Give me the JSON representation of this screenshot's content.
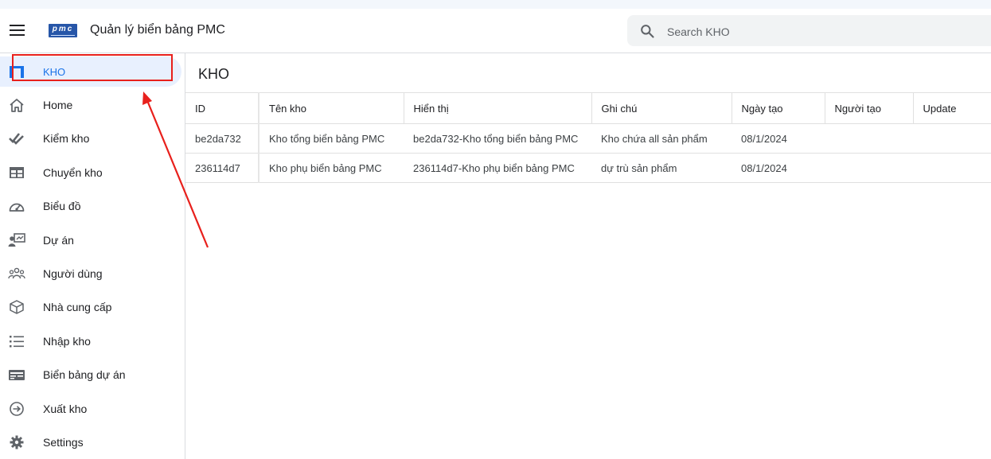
{
  "app": {
    "title": "Quản lý biển bảng PMC",
    "logo_text": "pmc"
  },
  "search": {
    "placeholder": "Search KHO"
  },
  "sidebar": {
    "items": [
      {
        "label": "KHO",
        "icon": "warehouse-icon",
        "active": true
      },
      {
        "label": "Home",
        "icon": "home-icon"
      },
      {
        "label": "Kiểm kho",
        "icon": "check-done-icon"
      },
      {
        "label": "Chuyển kho",
        "icon": "table-icon"
      },
      {
        "label": "Biểu đồ",
        "icon": "speedometer-icon"
      },
      {
        "label": "Dự án",
        "icon": "presentation-user-icon"
      },
      {
        "label": "Người dùng",
        "icon": "people-icon"
      },
      {
        "label": "Nhà cung cấp",
        "icon": "box-icon"
      },
      {
        "label": "Nhập kho",
        "icon": "list-icon"
      },
      {
        "label": "Biển bảng dự án",
        "icon": "card-icon"
      },
      {
        "label": "Xuất kho",
        "icon": "arrow-circle-right-icon"
      },
      {
        "label": "Settings",
        "icon": "gear-icon"
      }
    ]
  },
  "main": {
    "title": "KHO",
    "columns": [
      "ID",
      "Tên kho",
      "Hiển thị",
      "Ghi chú",
      "Ngày tạo",
      "Người tạo",
      "Update"
    ],
    "rows": [
      [
        "be2da732",
        "Kho tổng biển bảng PMC",
        "be2da732-Kho tổng biển bảng PMC",
        "Kho chứa all sản phẩm",
        "08/1/2024",
        "",
        ""
      ],
      [
        "236114d7",
        "Kho phụ biển bảng PMC",
        "236114d7-Kho phụ biển bảng PMC",
        "dự trù sản phẩm",
        "08/1/2024",
        "",
        ""
      ]
    ]
  },
  "colors": {
    "accent": "#1a73e8",
    "active_bg": "#e8f0fe",
    "annotation": "#e8201c",
    "logo": "#2756a8"
  }
}
